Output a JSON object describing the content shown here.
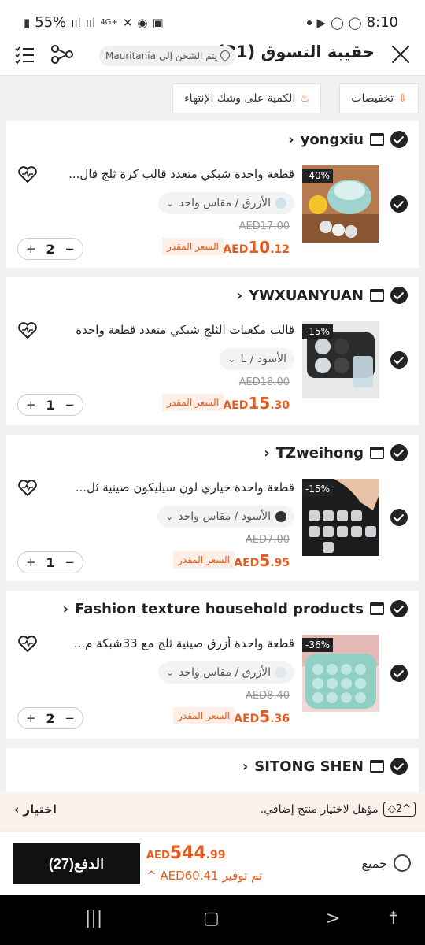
{
  "status_bar": {
    "battery": "55%",
    "network": "4G+",
    "time": "8:10"
  },
  "header": {
    "title": "حقيبة التسوق",
    "count": "(31)",
    "shipping_prefix": "يتم الشحن إلى",
    "shipping_country": "Mauritania"
  },
  "filters": {
    "discounts": "تخفيضات",
    "low_stock": "الكمية على وشك الإنتهاء"
  },
  "stores": [
    {
      "name": "yongxiu",
      "item": {
        "title": "قطعة واحدة شبكي متعدد قالب كرة ثلج قال...",
        "badge": "-40%",
        "variant": "الأزرق / مقاس واحد",
        "swatch_color": "#cfe4ec",
        "old_price": "AED17.00",
        "price_currency": "AED",
        "price_int": "10",
        "price_dec": ".12",
        "est_label": "السعر المقدر",
        "qty": "2"
      }
    },
    {
      "name": "YWXUANYUAN",
      "item": {
        "title": "قالب مكعبات الثلج شبكي متعدد قطعة واحدة",
        "badge": "-15%",
        "variant": "الأسود / L",
        "swatch_color": "",
        "old_price": "AED18.00",
        "price_currency": "AED",
        "price_int": "15",
        "price_dec": ".30",
        "est_label": "السعر المقدر",
        "qty": "1"
      }
    },
    {
      "name": "TZweihong",
      "item": {
        "title": "قطعة واحدة خياري لون سيليكون صينية ثل...",
        "badge": "-15%",
        "variant": "الأسود / مقاس واحد",
        "swatch_color": "#333333",
        "old_price": "AED7.00",
        "price_currency": "AED",
        "price_int": "5",
        "price_dec": ".95",
        "est_label": "السعر المقدر",
        "qty": "1"
      }
    },
    {
      "name": "Fashion texture household products",
      "item": {
        "title": "قطعة واحدة أزرق صينية ثلج مع 33شبكة م...",
        "badge": "-36%",
        "variant": "الأزرق / مقاس واحد",
        "swatch_color": "#dfe8ef",
        "old_price": "AED8.40",
        "price_currency": "AED",
        "price_int": "5",
        "price_dec": ".36",
        "est_label": "السعر المقدر",
        "qty": "2"
      }
    },
    {
      "name": "SITONG SHEN"
    }
  ],
  "promo": {
    "count": "2",
    "text": "مؤهل لاختيار منتج إضافي.",
    "link": "اختيار"
  },
  "checkout": {
    "pay_label": "الدفع",
    "pay_count": "(27)",
    "total_currency": "AED",
    "total_int": "544",
    "total_dec": ".99",
    "saving_label": "تم توفير",
    "saving_amount": "AED60.41",
    "select_all": "جميع"
  },
  "colors": {
    "accent": "#e85a1b",
    "dark": "#111111"
  }
}
